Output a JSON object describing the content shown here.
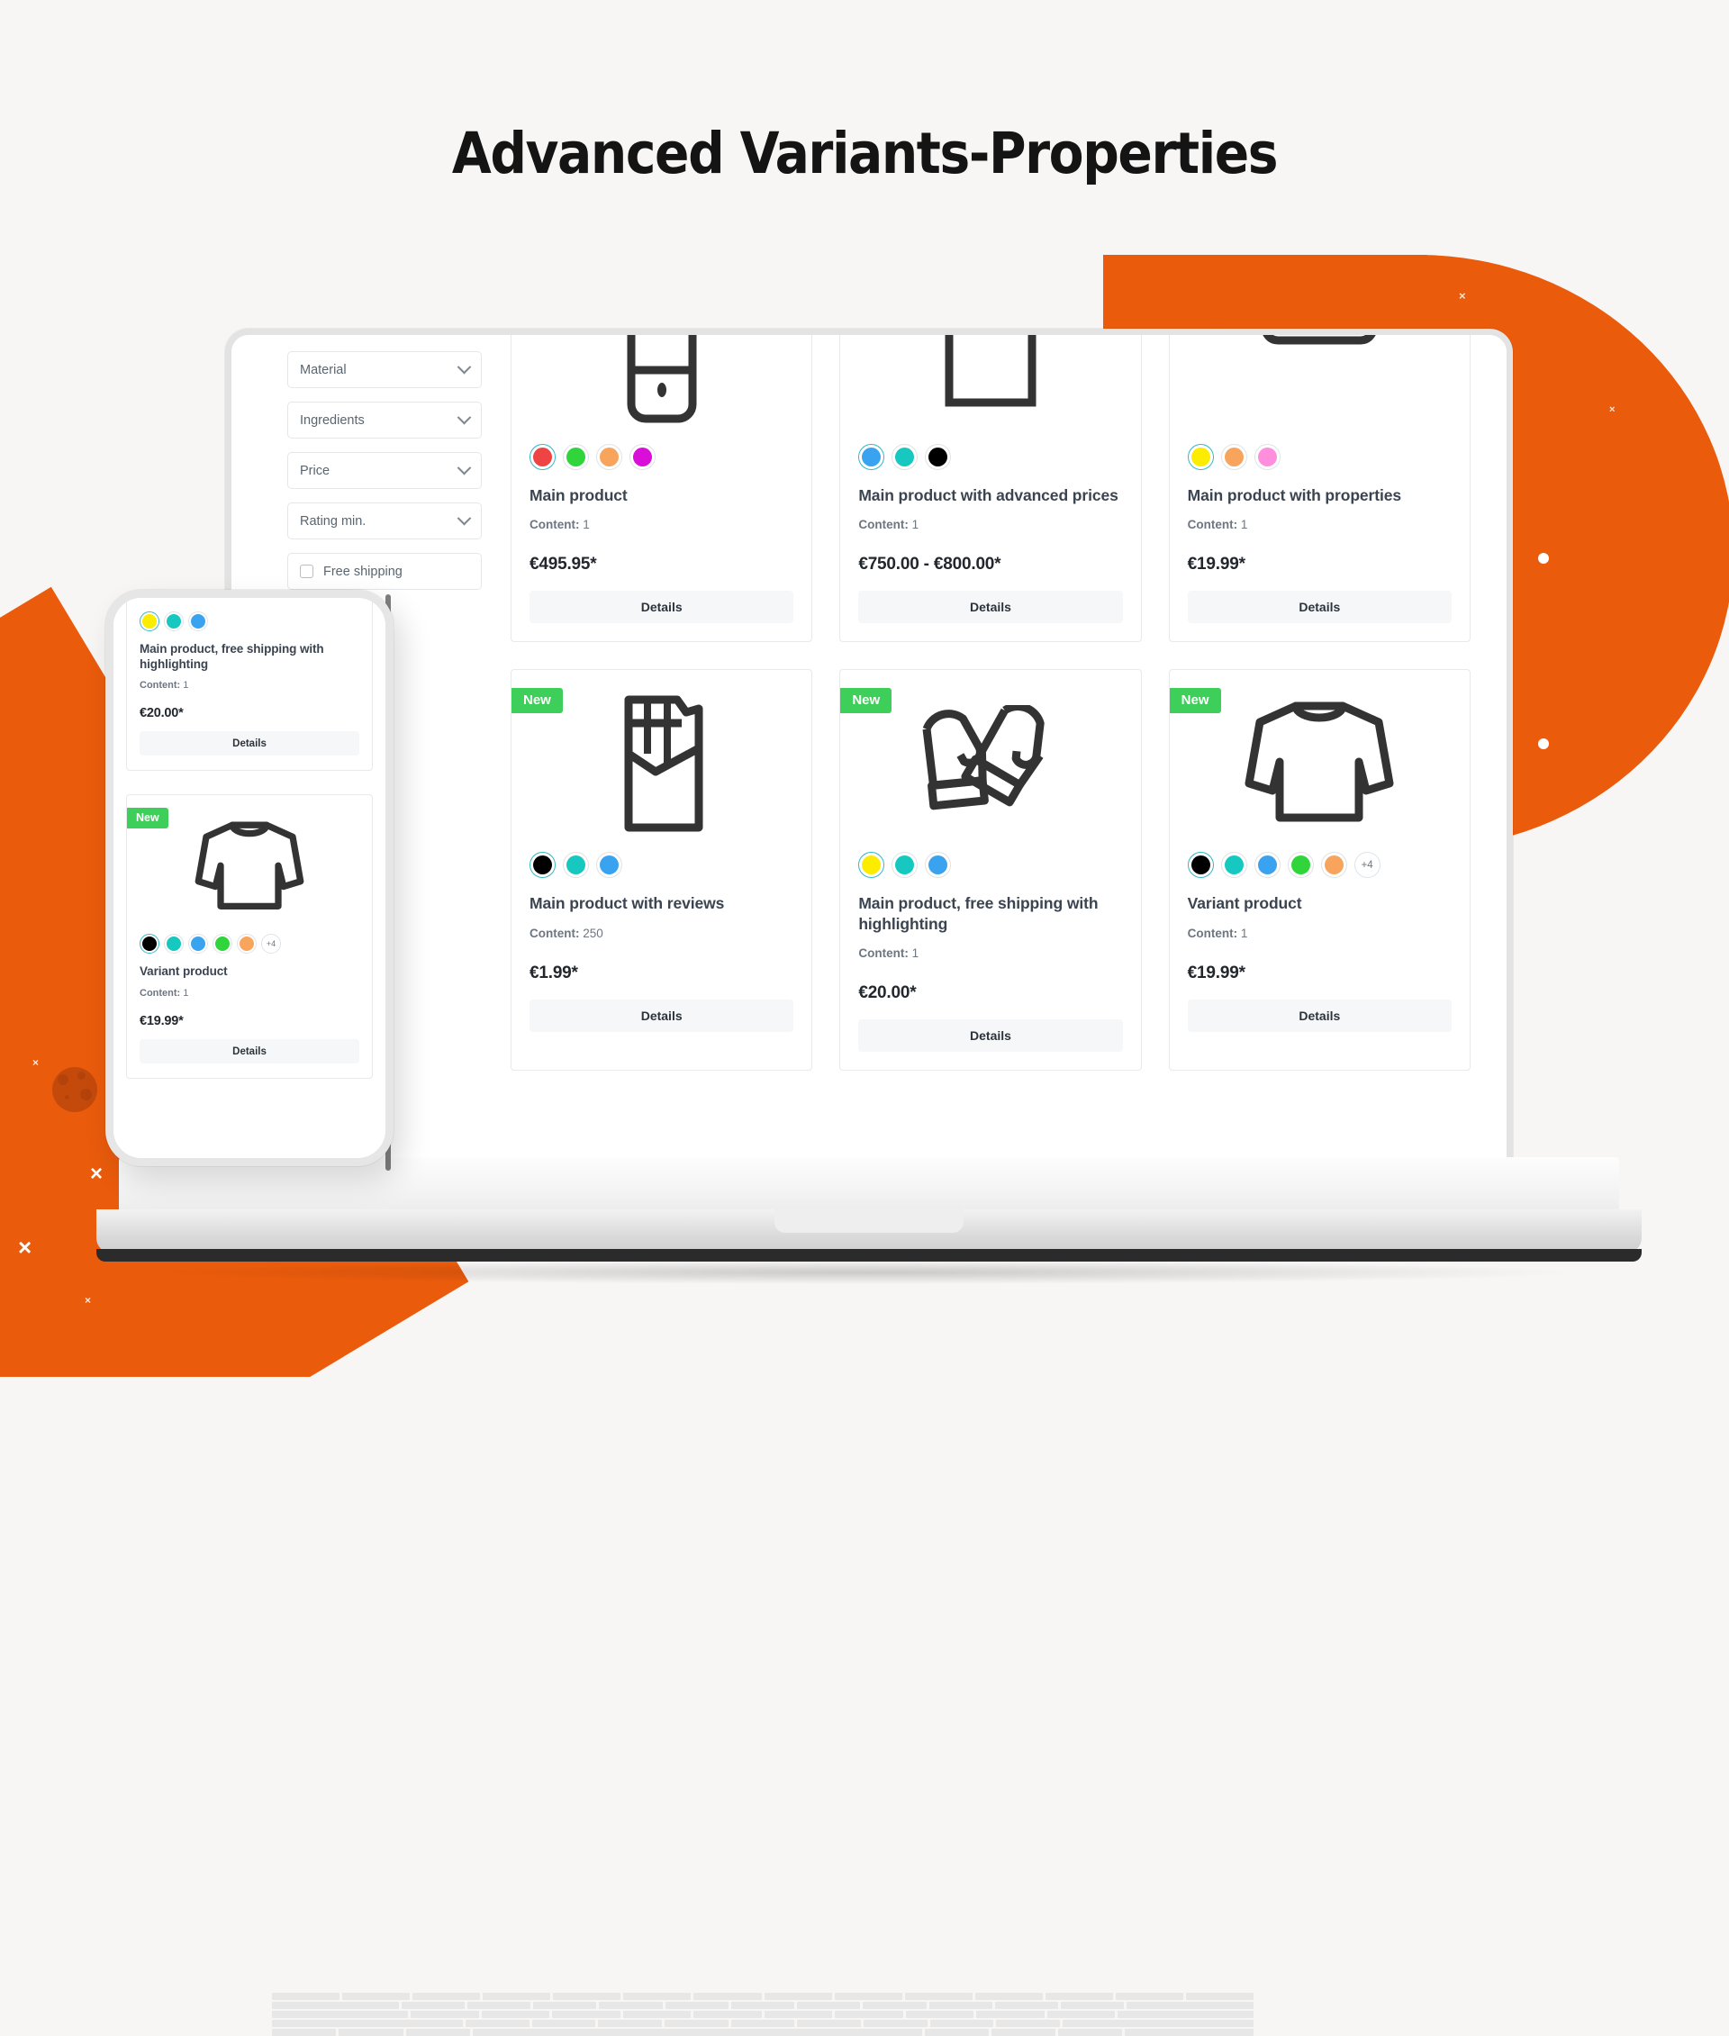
{
  "page": {
    "title": "Advanced Variants-Properties",
    "accent_color": "#ea5b0c",
    "badge_color": "#3ecf5a",
    "selected_ring_color": "#35b9c4"
  },
  "filters": {
    "items": [
      {
        "label": "Material",
        "type": "select",
        "icon": "chevron-down-icon"
      },
      {
        "label": "Ingredients",
        "type": "select",
        "icon": "chevron-down-icon"
      },
      {
        "label": "Price",
        "type": "select",
        "icon": "chevron-down-icon"
      },
      {
        "label": "Rating min.",
        "type": "select",
        "icon": "chevron-down-icon"
      },
      {
        "label": "Free shipping",
        "type": "checkbox",
        "checked": false
      }
    ]
  },
  "labels": {
    "content_label": "Content:",
    "details": "Details",
    "new_badge": "New",
    "more_swatches": "+4"
  },
  "products": [
    {
      "id": "main-product",
      "icon": "smartphone-icon",
      "new": false,
      "title": "Main product",
      "content": "1",
      "price": "€495.95*",
      "swatches": [
        "#ef4444",
        "#2fd53a",
        "#f9a45c",
        "#d90ed9"
      ],
      "selected_index": 0,
      "extra_swatches": null
    },
    {
      "id": "main-product-advanced-prices",
      "icon": "speaker-icon",
      "new": false,
      "title": "Main product with advanced prices",
      "content": "1",
      "price": "€750.00 - €800.00*",
      "swatches": [
        "#3aa3ef",
        "#16c8c0",
        "#000000"
      ],
      "selected_index": 0,
      "extra_swatches": null
    },
    {
      "id": "main-product-properties",
      "icon": "shirt-icon",
      "new": false,
      "title": "Main product with properties",
      "content": "1",
      "price": "€19.99*",
      "swatches": [
        "#fbec00",
        "#f9a45c",
        "#ff8fdd"
      ],
      "selected_index": 0,
      "extra_swatches": null
    },
    {
      "id": "main-product-reviews",
      "icon": "chocolate-bar-icon",
      "new": true,
      "title": "Main product with reviews",
      "content": "250",
      "price": "€1.99*",
      "swatches": [
        "#000000",
        "#16c8c0",
        "#3aa3ef"
      ],
      "selected_index": 0,
      "extra_swatches": null
    },
    {
      "id": "main-product-free-shipping",
      "icon": "mittens-icon",
      "new": true,
      "title": "Main product, free shipping with highlighting",
      "content": "1",
      "price": "€20.00*",
      "swatches": [
        "#fbec00",
        "#16c8c0",
        "#3aa3ef"
      ],
      "selected_index": 0,
      "extra_swatches": null
    },
    {
      "id": "variant-product",
      "icon": "longsleeve-shirt-icon",
      "new": true,
      "title": "Variant product",
      "content": "1",
      "price": "€19.99*",
      "swatches": [
        "#000000",
        "#16c8c0",
        "#3aa3ef",
        "#2fd53a",
        "#f9a45c"
      ],
      "selected_index": 0,
      "extra_swatches": "+4"
    }
  ],
  "phone_products": [
    {
      "id": "phone-main-product-free-shipping",
      "icon": null,
      "new": false,
      "title": "Main product, free shipping with highlighting",
      "content": "1",
      "price": "€20.00*",
      "swatches": [
        "#fbec00",
        "#16c8c0",
        "#3aa3ef"
      ],
      "selected_index": 0,
      "extra_swatches": null
    },
    {
      "id": "phone-variant-product",
      "icon": "longsleeve-shirt-icon",
      "new": true,
      "title": "Variant product",
      "content": "1",
      "price": "€19.99*",
      "swatches": [
        "#000000",
        "#16c8c0",
        "#3aa3ef",
        "#2fd53a",
        "#f9a45c"
      ],
      "selected_index": 0,
      "extra_swatches": "+4"
    }
  ]
}
